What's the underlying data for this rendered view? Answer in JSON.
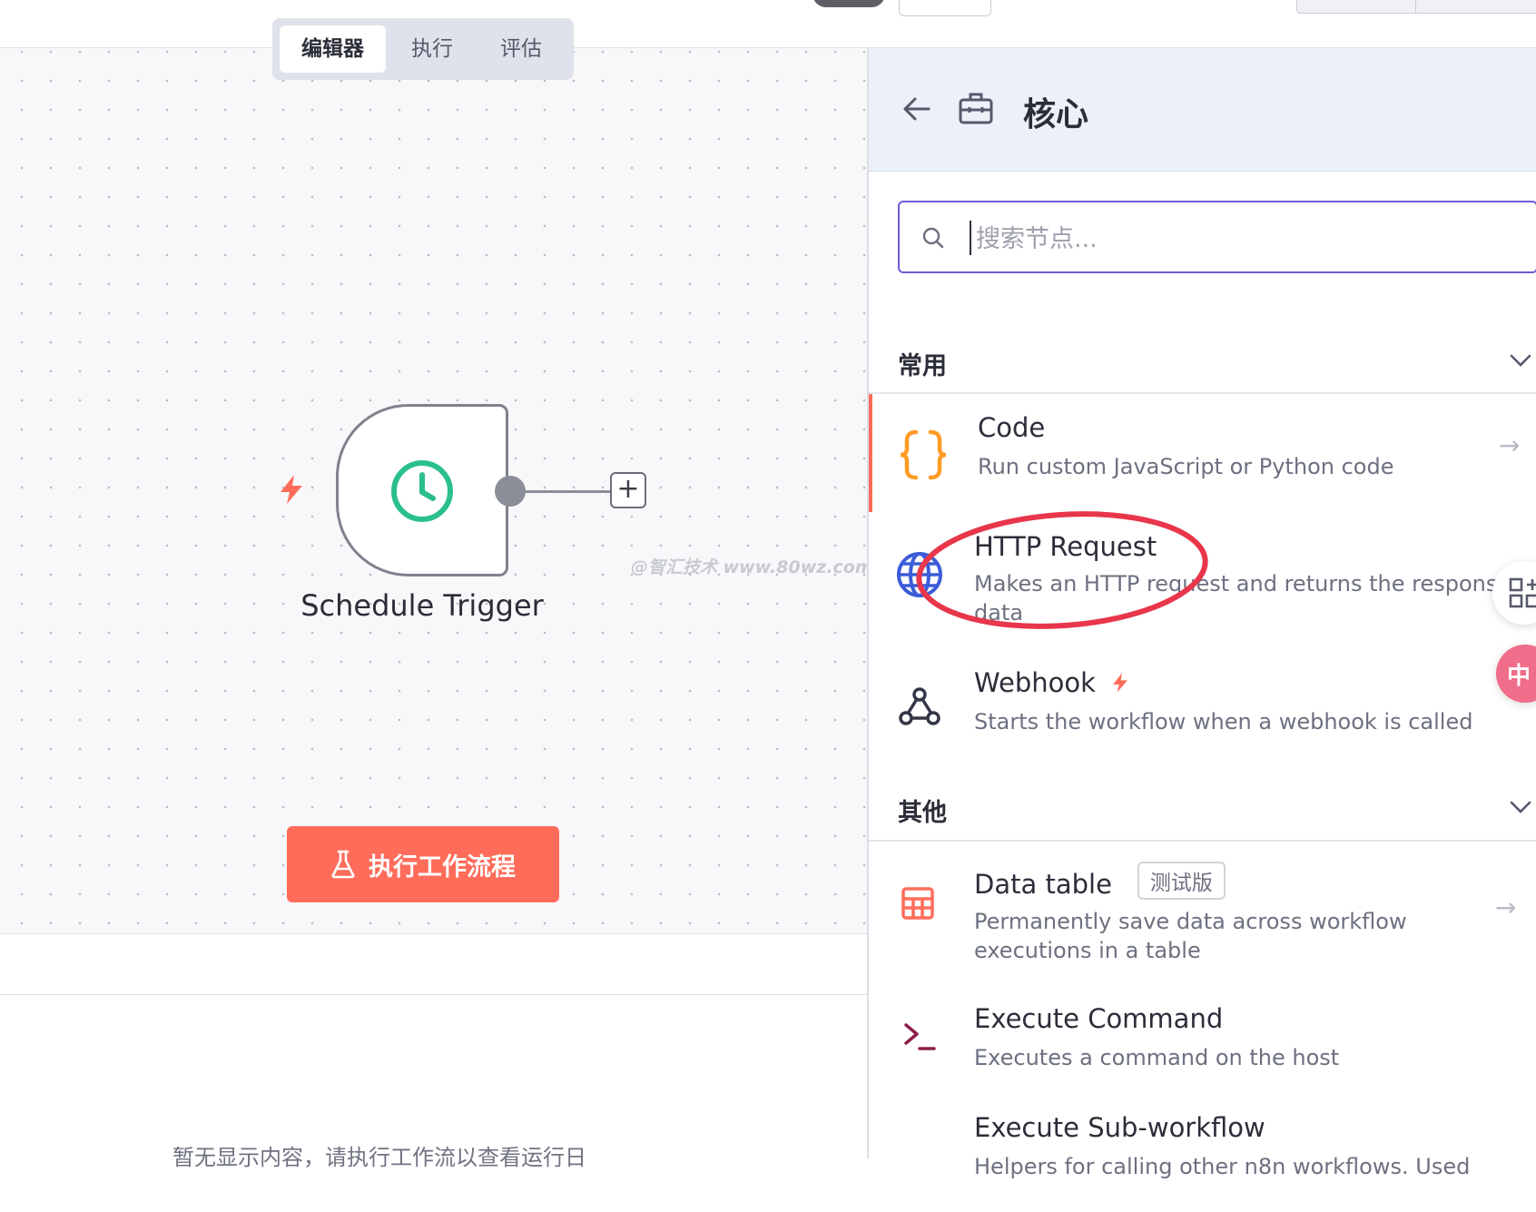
{
  "tabs": {
    "editor": "编辑器",
    "executions": "执行",
    "evaluation": "评估"
  },
  "canvas": {
    "node": {
      "name": "Schedule Trigger",
      "icon": "clock-icon"
    },
    "execute_button": "执行工作流程",
    "empty_message": "暂无显示内容，请执行工作流以查看运行日",
    "watermark": "@智汇技术 www.80wz.com"
  },
  "panel": {
    "title": "核心",
    "search_placeholder": "搜索节点...",
    "sections": [
      {
        "title": "常用",
        "items": [
          {
            "title": "Code",
            "desc": "Run custom JavaScript or Python code",
            "icon": "code-braces-icon"
          },
          {
            "title": "HTTP Request",
            "desc": "Makes an HTTP request and returns the response data",
            "icon": "globe-icon"
          },
          {
            "title": "Webhook",
            "desc": "Starts the workflow when a webhook is called",
            "icon": "webhook-icon"
          }
        ]
      },
      {
        "title": "其他",
        "items": [
          {
            "title": "Data table",
            "badge": "测试版",
            "desc": "Permanently save data across workflow executions in a table",
            "icon": "table-icon"
          },
          {
            "title": "Execute Command",
            "desc": "Executes a command on the host",
            "icon": "terminal-icon"
          },
          {
            "title": "Execute Sub-workflow",
            "desc": "Helpers for calling other n8n workflows. Used",
            "icon": "sub-workflow-icon"
          }
        ]
      }
    ]
  },
  "colors": {
    "accent": "#ff6d5a",
    "search_border": "#6c5fd8",
    "trigger_green": "#2bbf8e",
    "highlight_ring": "#e8364a"
  }
}
